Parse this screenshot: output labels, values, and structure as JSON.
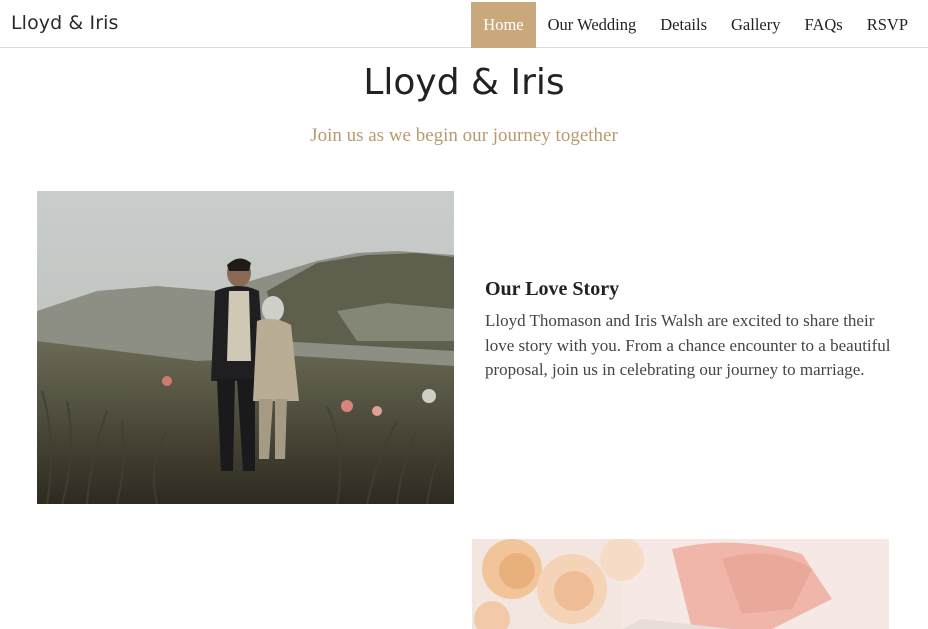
{
  "header": {
    "brand": "Lloyd & Iris",
    "nav": [
      {
        "label": "Home",
        "active": true
      },
      {
        "label": "Our Wedding",
        "active": false
      },
      {
        "label": "Details",
        "active": false
      },
      {
        "label": "Gallery",
        "active": false
      },
      {
        "label": "FAQs",
        "active": false
      },
      {
        "label": "RSVP",
        "active": false
      }
    ]
  },
  "hero": {
    "title": "Lloyd & Iris",
    "subtitle": "Join us as we begin our journey together"
  },
  "story": {
    "title": "Our Love Story",
    "text": "Lloyd Thomason and Iris Walsh are excited to share their love story with you. From a chance encounter to a beautiful proposal, join us in celebrating our journey to marriage."
  },
  "colors": {
    "accent": "#c9a97c",
    "subtitle": "#b89a6e"
  }
}
